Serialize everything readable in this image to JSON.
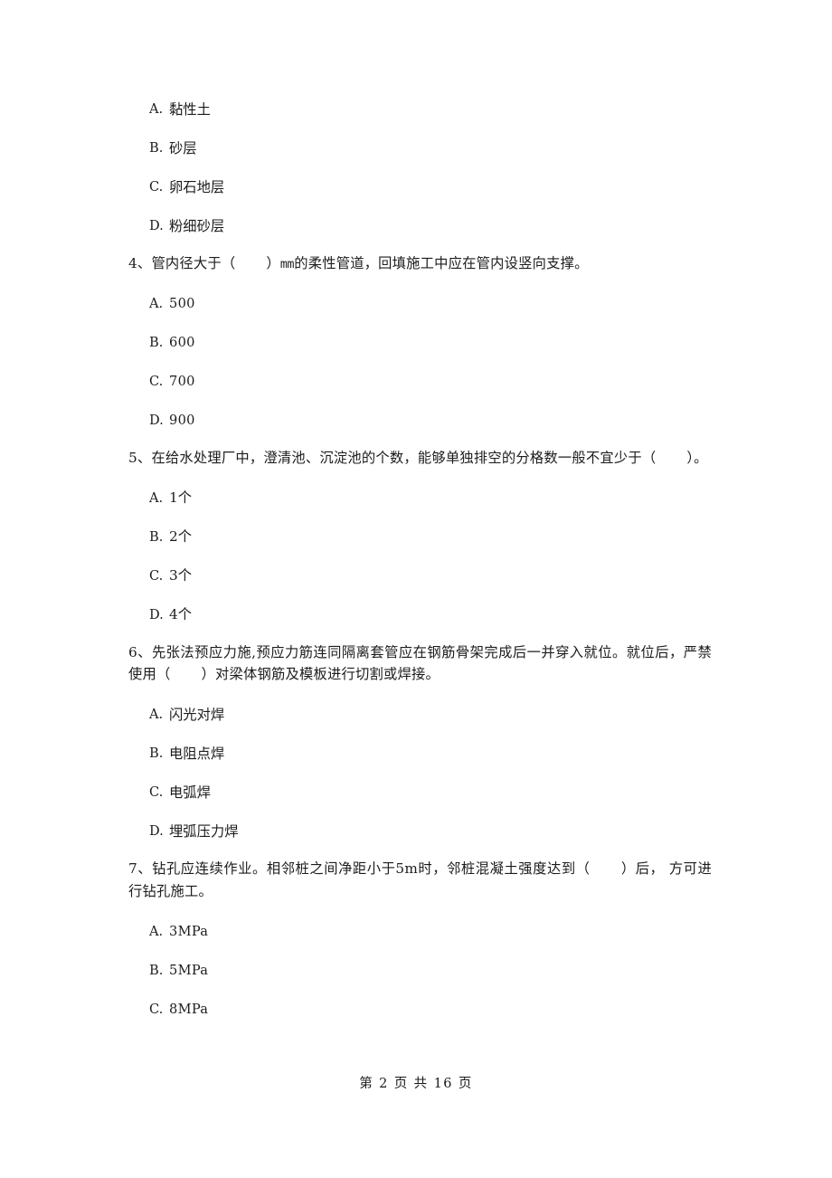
{
  "document": {
    "type": "exam-paper",
    "language": "zh-CN",
    "page_number": 2,
    "total_pages": 16,
    "footer_text": "第 2 页 共 16 页",
    "background_color": "#ffffff",
    "text_color": "#1c1c1c"
  },
  "partial_question_top": {
    "note": "options continuing from previous page question 3",
    "options": [
      {
        "letter": "A.",
        "text": "黏性土",
        "script": "han"
      },
      {
        "letter": "B.",
        "text": "砂层",
        "script": "han"
      },
      {
        "letter": "C.",
        "text": "卵石地层",
        "script": "han"
      },
      {
        "letter": "D.",
        "text": "粉细砂层",
        "script": "han"
      }
    ]
  },
  "questions": [
    {
      "number": "4、",
      "stem_before_blank": "管内径大于（",
      "stem_after_blank": "）",
      "unit": "mm",
      "stem_tail": "的柔性管道，回填施工中应在管内设竖向支撑。",
      "full_text": "4、管内径大于（   ）mm的柔性管道，回填施工中应在管内设竖向支撑。",
      "options": [
        {
          "letter": "A.",
          "text": "500",
          "script": "latin"
        },
        {
          "letter": "B.",
          "text": "600",
          "script": "latin"
        },
        {
          "letter": "C.",
          "text": "700",
          "script": "latin"
        },
        {
          "letter": "D.",
          "text": "900",
          "script": "latin"
        }
      ]
    },
    {
      "number": "5、",
      "stem_before_blank": "在给水处理厂中，澄清池、沉淀池的个数，能够单独排空的分格数一般不宜少于（",
      "stem_after_blank": "）。",
      "unit": "",
      "stem_tail": "",
      "full_text": "5、在给水处理厂中，澄清池、沉淀池的个数，能够单独排空的分格数一般不宜少于（   ）。",
      "options": [
        {
          "letter": "A.",
          "text": "1个",
          "script": "han"
        },
        {
          "letter": "B.",
          "text": "2个",
          "script": "han"
        },
        {
          "letter": "C.",
          "text": "3个",
          "script": "han"
        },
        {
          "letter": "D.",
          "text": "4个",
          "script": "han"
        }
      ]
    },
    {
      "number": "6、",
      "stem_before_blank": "先张法预应力施,预应力筋连同隔离套管应在钢筋骨架完成后一并穿入就位。就位后，严禁使用（",
      "stem_after_blank": "）",
      "unit": "",
      "stem_tail": "对梁体钢筋及模板进行切割或焊接。",
      "full_text": "6、先张法预应力施,预应力筋连同隔离套管应在钢筋骨架完成后一并穿入就位。就位后，严禁使用（   ）对梁体钢筋及模板进行切割或焊接。",
      "options": [
        {
          "letter": "A.",
          "text": "闪光对焊",
          "script": "han"
        },
        {
          "letter": "B.",
          "text": "电阻点焊",
          "script": "han"
        },
        {
          "letter": "C.",
          "text": "电弧焊",
          "script": "han"
        },
        {
          "letter": "D.",
          "text": "埋弧压力焊",
          "script": "han"
        }
      ]
    },
    {
      "number": "7、",
      "stem_before_blank": "钻孔应连续作业。相邻桩之间净距小于5m时，邻桩混凝土强度达到（",
      "stem_after_blank": "）后，",
      "unit": "",
      "stem_tail": " 方可进行钻孔施工。",
      "full_text": "7、钻孔应连续作业。相邻桩之间净距小于5m时，邻桩混凝土强度达到（   ）后， 方可进行钻孔施工。",
      "options": [
        {
          "letter": "A.",
          "text": "3MPa",
          "script": "latin"
        },
        {
          "letter": "B.",
          "text": "5MPa",
          "script": "latin"
        },
        {
          "letter": "C.",
          "text": "8MPa",
          "script": "latin"
        }
      ]
    }
  ]
}
